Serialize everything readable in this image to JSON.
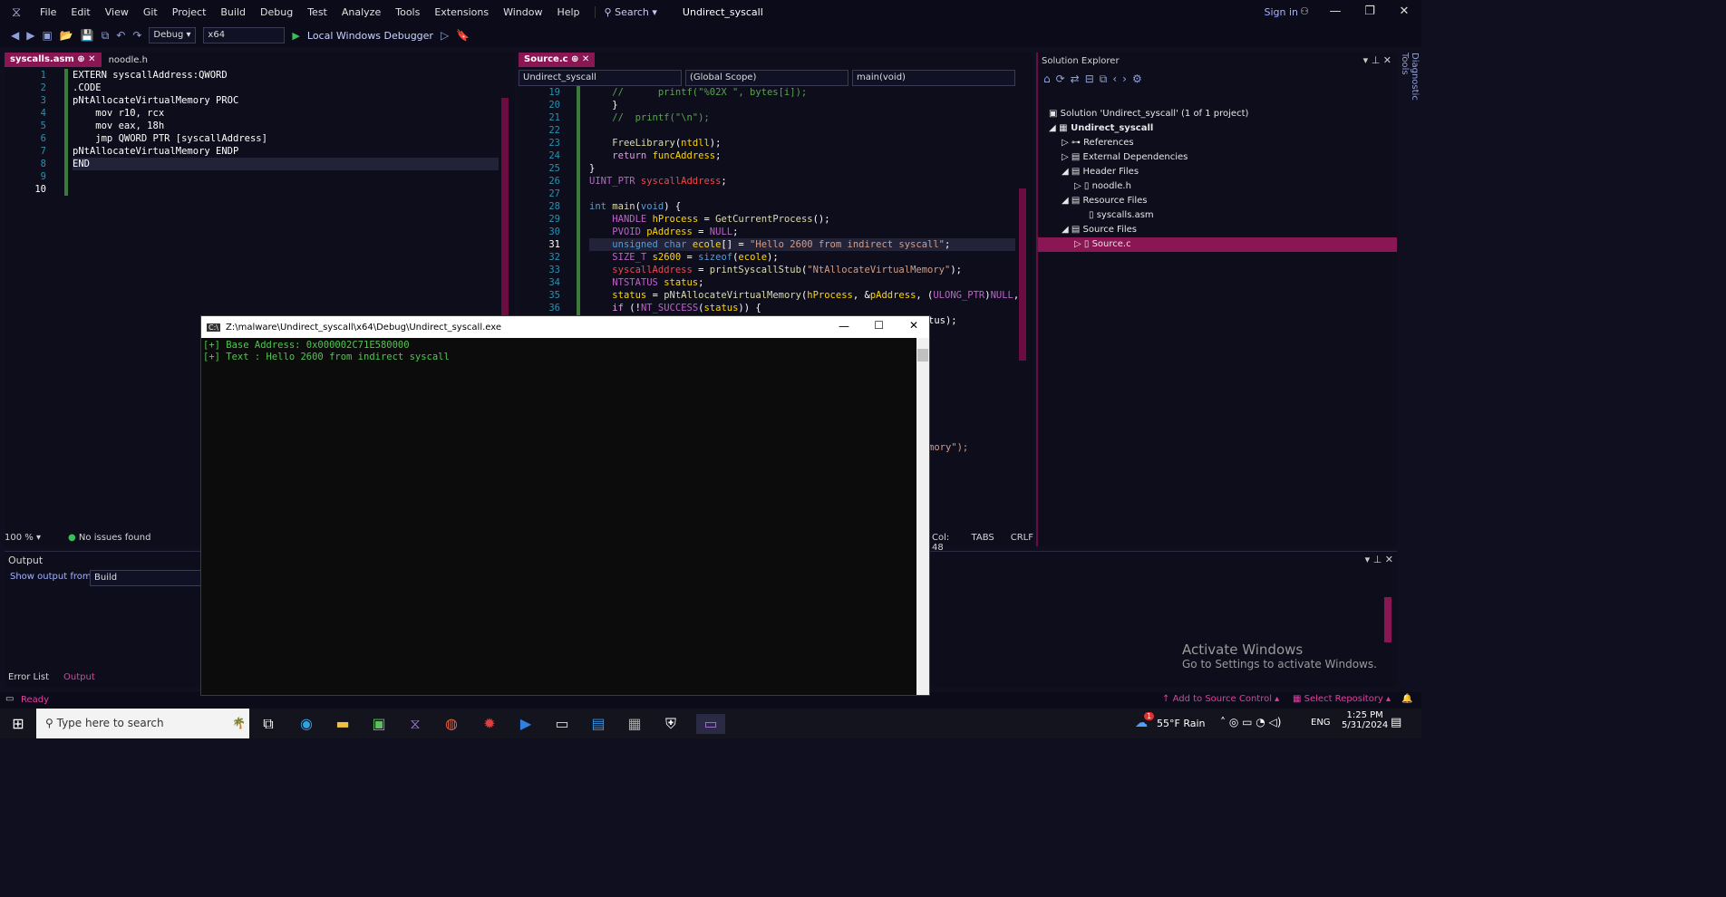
{
  "titlebar": {
    "menus": [
      "File",
      "Edit",
      "View",
      "Git",
      "Project",
      "Build",
      "Debug",
      "Test",
      "Analyze",
      "Tools",
      "Extensions",
      "Window",
      "Help"
    ],
    "search": "Search",
    "project": "Undirect_syscall",
    "signin": "Sign in"
  },
  "toolbar": {
    "config": "Debug",
    "platform": "x64",
    "run_label": "Local Windows Debugger"
  },
  "left_editor": {
    "tabs": [
      "syscalls.asm",
      "noodle.h"
    ],
    "zoom": "100 %",
    "issues": "No issues found",
    "line_numbers": [
      "1",
      "2",
      "3",
      "4",
      "5",
      "6",
      "7",
      "8",
      "9",
      "10"
    ],
    "lines": [
      "EXTERN syscallAddress:QWORD",
      ".CODE",
      "",
      "pNtAllocateVirtualMemory PROC",
      "    mov r10, rcx",
      "    mov eax, 18h",
      "    jmp QWORD PTR [syscallAddress]",
      "pNtAllocateVirtualMemory ENDP",
      "",
      "END"
    ]
  },
  "right_editor": {
    "tab": "Source.c",
    "nav_project": "Undirect_syscall",
    "nav_scope": "(Global Scope)",
    "nav_member": "main(void)",
    "line_numbers": [
      "19",
      "20",
      "21",
      "22",
      "23",
      "24",
      "25",
      "26",
      "27",
      "28",
      "29",
      "30",
      "31",
      "32",
      "33",
      "34",
      "35",
      "36"
    ],
    "status_col": "Col: 48",
    "status_tabs": "TABS",
    "status_crlf": "CRLF",
    "tail_lines": [
      "tus);",
      "mory\");"
    ]
  },
  "solution_explorer": {
    "title": "Solution Explorer",
    "solution": "Solution 'Undirect_syscall' (1 of 1 project)",
    "project": "Undirect_syscall",
    "references": "References",
    "external": "External Dependencies",
    "header_files": "Header Files",
    "noodle": "noodle.h",
    "resource_files": "Resource Files",
    "syscalls": "syscalls.asm",
    "source_files": "Source Files",
    "source_c": "Source.c",
    "diagnostic_tab": "Diagnostic Tools"
  },
  "output": {
    "title": "Output",
    "show_from_label": "Show output from:",
    "show_from_value": "Build",
    "bottom_tabs": [
      "Error List",
      "Output"
    ]
  },
  "console": {
    "title": "Z:\\malware\\Undirect_syscall\\x64\\Debug\\Undirect_syscall.exe",
    "lines": [
      "[+] Base Address: 0x000002C71E580000",
      "[+] Text : Hello 2600 from indirect syscall"
    ]
  },
  "statusbar": {
    "ready": "Ready",
    "add_source": "Add to Source Control",
    "select_repo": "Select Repository"
  },
  "watermark": {
    "line1": "Activate Windows",
    "line2": "Go to Settings to activate Windows."
  },
  "taskbar": {
    "search_placeholder": "Type here to search",
    "weather": "55°F  Rain",
    "lang": "ENG",
    "time": "1:25 PM",
    "date": "5/31/2024",
    "notif_badge": "1"
  }
}
